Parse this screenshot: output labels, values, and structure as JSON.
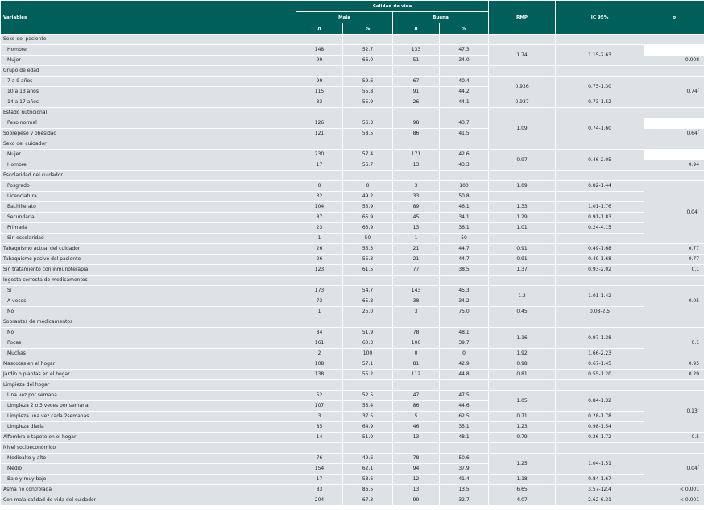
{
  "header": {
    "variables": "Variables",
    "calidad": "Calidad de vida",
    "mala": "Mala",
    "buena": "Buena",
    "rmp": "RMP",
    "ic": "IC 95%",
    "p": "p",
    "n1": "n",
    "pct1": "%",
    "n2": "n",
    "pct2": "%"
  },
  "rows": {
    "r0": {
      "label": "Sexo del paciente"
    },
    "r1": {
      "label": "Hombre",
      "n1": "148",
      "p1": "52.7",
      "n2": "133",
      "p2": "47.3",
      "rmp": "1.74",
      "ic": "1.15-2.63"
    },
    "r2": {
      "label": "Mujer",
      "n1": "99",
      "p1": "66.0",
      "n2": "51",
      "p2": "34.0",
      "p": "0.008"
    },
    "r3": {
      "label": "Grupo de edad"
    },
    "r4": {
      "label": "7 a 9 años",
      "n1": "99",
      "p1": "59.6",
      "n2": "67",
      "p2": "40.4",
      "rmp": "0.936",
      "ic": "0.75-1.30",
      "p": "0.74",
      "dag": "†"
    },
    "r5": {
      "label": "10 a 13 años",
      "n1": "115",
      "p1": "55.8",
      "n2": "91",
      "p2": "44.2"
    },
    "r6": {
      "label": "14 a 17 años",
      "n1": "33",
      "p1": "55.9",
      "n2": "26",
      "p2": "44.1",
      "rmp": "0.937",
      "ic": "0.73-1.52"
    },
    "r7": {
      "label": "Estado nutricional"
    },
    "r8": {
      "label": "Peso normal",
      "n1": "126",
      "p1": "56.3",
      "n2": "98",
      "p2": "43.7",
      "rmp": "1.09",
      "ic": "0.74-1.60"
    },
    "r9": {
      "label": "Sobrepeso y obesidad",
      "n1": "121",
      "p1": "58.5",
      "n2": "86",
      "p2": "41.5",
      "p": "0.64",
      "dag": "†"
    },
    "r10": {
      "label": "Sexo del cuidador"
    },
    "r11": {
      "label": "Mujer",
      "n1": "230",
      "p1": "57.4",
      "n2": "171",
      "p2": "42.6",
      "rmp": "0.97",
      "ic": "0.46-2.05"
    },
    "r12": {
      "label": "Hombre",
      "n1": "17",
      "p1": "56.7",
      "n2": "13",
      "p2": "43.3",
      "p": "0.94"
    },
    "r13": {
      "label": "Escolaridad del cuidador"
    },
    "r14": {
      "label": "Posgrado",
      "n1": "0",
      "p1": "0",
      "n2": "3",
      "p2": "100",
      "rmp": "1.09",
      "ic": "0.82-1.44"
    },
    "r15": {
      "label": "Licenciatura",
      "n1": "32",
      "p1": "49.2",
      "n2": "33",
      "p2": "50.8"
    },
    "r16": {
      "label": "Bachillerato",
      "n1": "104",
      "p1": "53.9",
      "n2": "89",
      "p2": "46.1",
      "rmp": "1.33",
      "ic": "1.01-1.76",
      "p": "0.04",
      "dag": "†"
    },
    "r17": {
      "label": "Secundaria",
      "n1": "87",
      "p1": "65.9",
      "n2": "45",
      "p2": "34.1",
      "rmp": "1.29",
      "ic": "0.91-1.83"
    },
    "r18": {
      "label": "Primaria",
      "n1": "23",
      "p1": "63.9",
      "n2": "13",
      "p2": "36.1",
      "rmp": "1.01",
      "ic": "0.24-4.15"
    },
    "r19": {
      "label": "Sin escolaridad",
      "n1": "1",
      "p1": "50",
      "n2": "1",
      "p2": "50"
    },
    "r20": {
      "label": "Tabaquismo actual del cuidador",
      "n1": "26",
      "p1": "55.3",
      "n2": "21",
      "p2": "44.7",
      "rmp": "0.91",
      "ic": "0.49-1.68",
      "p": "0.77"
    },
    "r21": {
      "label": "Tabaquismo pasivo del paciente",
      "n1": "26",
      "p1": "55.3",
      "n2": "21",
      "p2": "44.7",
      "rmp": "0.91",
      "ic": "0.49-1.68",
      "p": "0.77"
    },
    "r22": {
      "label": "Sin tratamiento con inmunoterapia",
      "n1": "123",
      "p1": "61.5",
      "n2": "77",
      "p2": "38.5",
      "rmp": "1.37",
      "ic": "0.93-2.02",
      "p": "0.1"
    },
    "r23": {
      "label": "Ingesta correcta de medicamentos"
    },
    "r24": {
      "label": "Sí",
      "n1": "173",
      "p1": "54.7",
      "n2": "143",
      "p2": "45.3",
      "rmp": "1.2",
      "ic": "1.01-1.42"
    },
    "r25": {
      "label": "A veces",
      "n1": "73",
      "p1": "65.8",
      "n2": "38",
      "p2": "34.2",
      "p": "0.05"
    },
    "r26": {
      "label": "No",
      "n1": "1",
      "p1": "25.0",
      "n2": "3",
      "p2": "75.0",
      "rmp": "0.45",
      "ic": "0.08-2.5"
    },
    "r27": {
      "label": "Sobrantes de medicamentos"
    },
    "r28": {
      "label": "No",
      "n1": "84",
      "p1": "51.9",
      "n2": "78",
      "p2": "48.1"
    },
    "r29": {
      "label": "Pocas",
      "n1": "161",
      "p1": "60.3",
      "n2": "106",
      "p2": "39.7",
      "rmp": "1.16",
      "ic": "0.97-1.38",
      "p": "0.1"
    },
    "r30": {
      "label": "Muchas",
      "n1": "2",
      "p1": "100",
      "n2": "0",
      "p2": "0",
      "rmp": "1.92",
      "ic": "1.66-2.23"
    },
    "r31": {
      "label": "Mascotas en el hogar",
      "n1": "108",
      "p1": "57.1",
      "n2": "81",
      "p2": "42.9",
      "rmp": "0.98",
      "ic": "0.67-1.45",
      "p": "0.95"
    },
    "r32": {
      "label": "Jardín o plantas en el hogar",
      "n1": "138",
      "p1": "55.2",
      "n2": "112",
      "p2": "44.8",
      "rmp": "0.81",
      "ic": "0.55-1.20",
      "p": "0.29"
    },
    "r33": {
      "label": "Limpieza del hogar"
    },
    "r34": {
      "label": "Una vez por semana",
      "n1": "52",
      "p1": "52.5",
      "n2": "47",
      "p2": "47.5",
      "rmp": "1.05",
      "ic": "0.84-1.32"
    },
    "r35": {
      "label": "Limpieza 2 o 3 veces por semana",
      "n1": "107",
      "p1": "55.4",
      "n2": "86",
      "p2": "44.6"
    },
    "r36": {
      "label": "Limpieza una vez cada 2semanas",
      "n1": "3",
      "p1": "37.5",
      "n2": "5",
      "p2": "62.5",
      "rmp": "0.71",
      "ic": "0.28-1.78",
      "p": "0.13",
      "dag": "†"
    },
    "r37": {
      "label": "Limpieza diaria",
      "n1": "85",
      "p1": "64.9",
      "n2": "46",
      "p2": "35.1",
      "rmp": "1.23",
      "ic": "0.98-1.54"
    },
    "r38": {
      "label": "Alfombra o tapete en el hogar",
      "n1": "14",
      "p1": "51.9",
      "n2": "13",
      "p2": "48.1",
      "rmp": "0.79",
      "ic": "0.36-1.72",
      "p": "0.5"
    },
    "r39": {
      "label": "Nivel socioeconómico"
    },
    "r40": {
      "label": "Medioalto y alto",
      "n1": "76",
      "p1": "49.6",
      "n2": "78",
      "p2": "50.6",
      "rmp": "1.25",
      "ic": "1.04-1.51"
    },
    "r41": {
      "label": "Medio",
      "n1": "154",
      "p1": "62.1",
      "n2": "94",
      "p2": "37.9",
      "p": "0.04",
      "dag": "†"
    },
    "r42": {
      "label": "Bajo y muy bajo",
      "n1": "17",
      "p1": "58.6",
      "n2": "12",
      "p2": "41.4",
      "rmp": "1.18",
      "ic": "0.84-1.67"
    },
    "r43": {
      "label": "Asma no controlada",
      "n1": "83",
      "p1": "86.5",
      "n2": "13",
      "p2": "13.5",
      "rmp": "6.65",
      "ic": "3.57-12.4",
      "p": "< 0.001"
    },
    "r44": {
      "label": "Con mala calidad de vida del cuidador",
      "n1": "204",
      "p1": "67.3",
      "n2": "99",
      "p2": "32.7",
      "rmp": "4.07",
      "ic": "2.62-6.31",
      "p": "< 0.001"
    }
  }
}
